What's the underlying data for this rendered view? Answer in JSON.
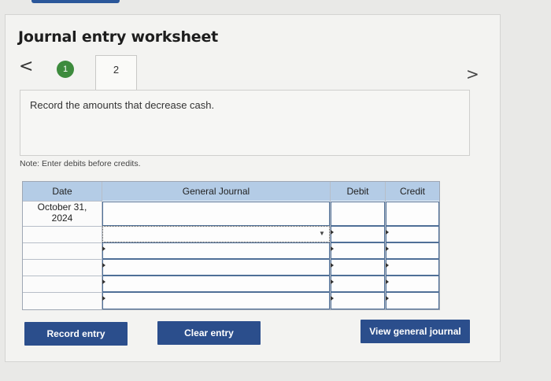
{
  "header": {
    "title": "Journal entry worksheet",
    "prev_glyph": "<",
    "next_glyph": ">"
  },
  "steps": [
    {
      "label": "1",
      "state": "completed"
    },
    {
      "label": "2",
      "state": "active"
    }
  ],
  "instruction": "Record the amounts that decrease cash.",
  "note": "Note: Enter debits before credits.",
  "journal": {
    "columns": [
      "Date",
      "General Journal",
      "Debit",
      "Credit"
    ],
    "rows": [
      {
        "date": "October 31, 2024",
        "account": "",
        "debit": "",
        "credit": ""
      },
      {
        "date": "",
        "account": "",
        "debit": "",
        "credit": ""
      },
      {
        "date": "",
        "account": "",
        "debit": "",
        "credit": ""
      },
      {
        "date": "",
        "account": "",
        "debit": "",
        "credit": ""
      },
      {
        "date": "",
        "account": "",
        "debit": "",
        "credit": ""
      },
      {
        "date": "",
        "account": "",
        "debit": "",
        "credit": ""
      }
    ],
    "date_line1": "October 31,",
    "date_line2": "2024",
    "dropdown_glyph": "▼"
  },
  "buttons": {
    "record": "Record entry",
    "clear": "Clear entry",
    "view": "View general journal"
  },
  "colors": {
    "button_bg": "#2b4e8c",
    "header_bg": "#b4cce6",
    "step_completed": "#3d8b3d"
  }
}
